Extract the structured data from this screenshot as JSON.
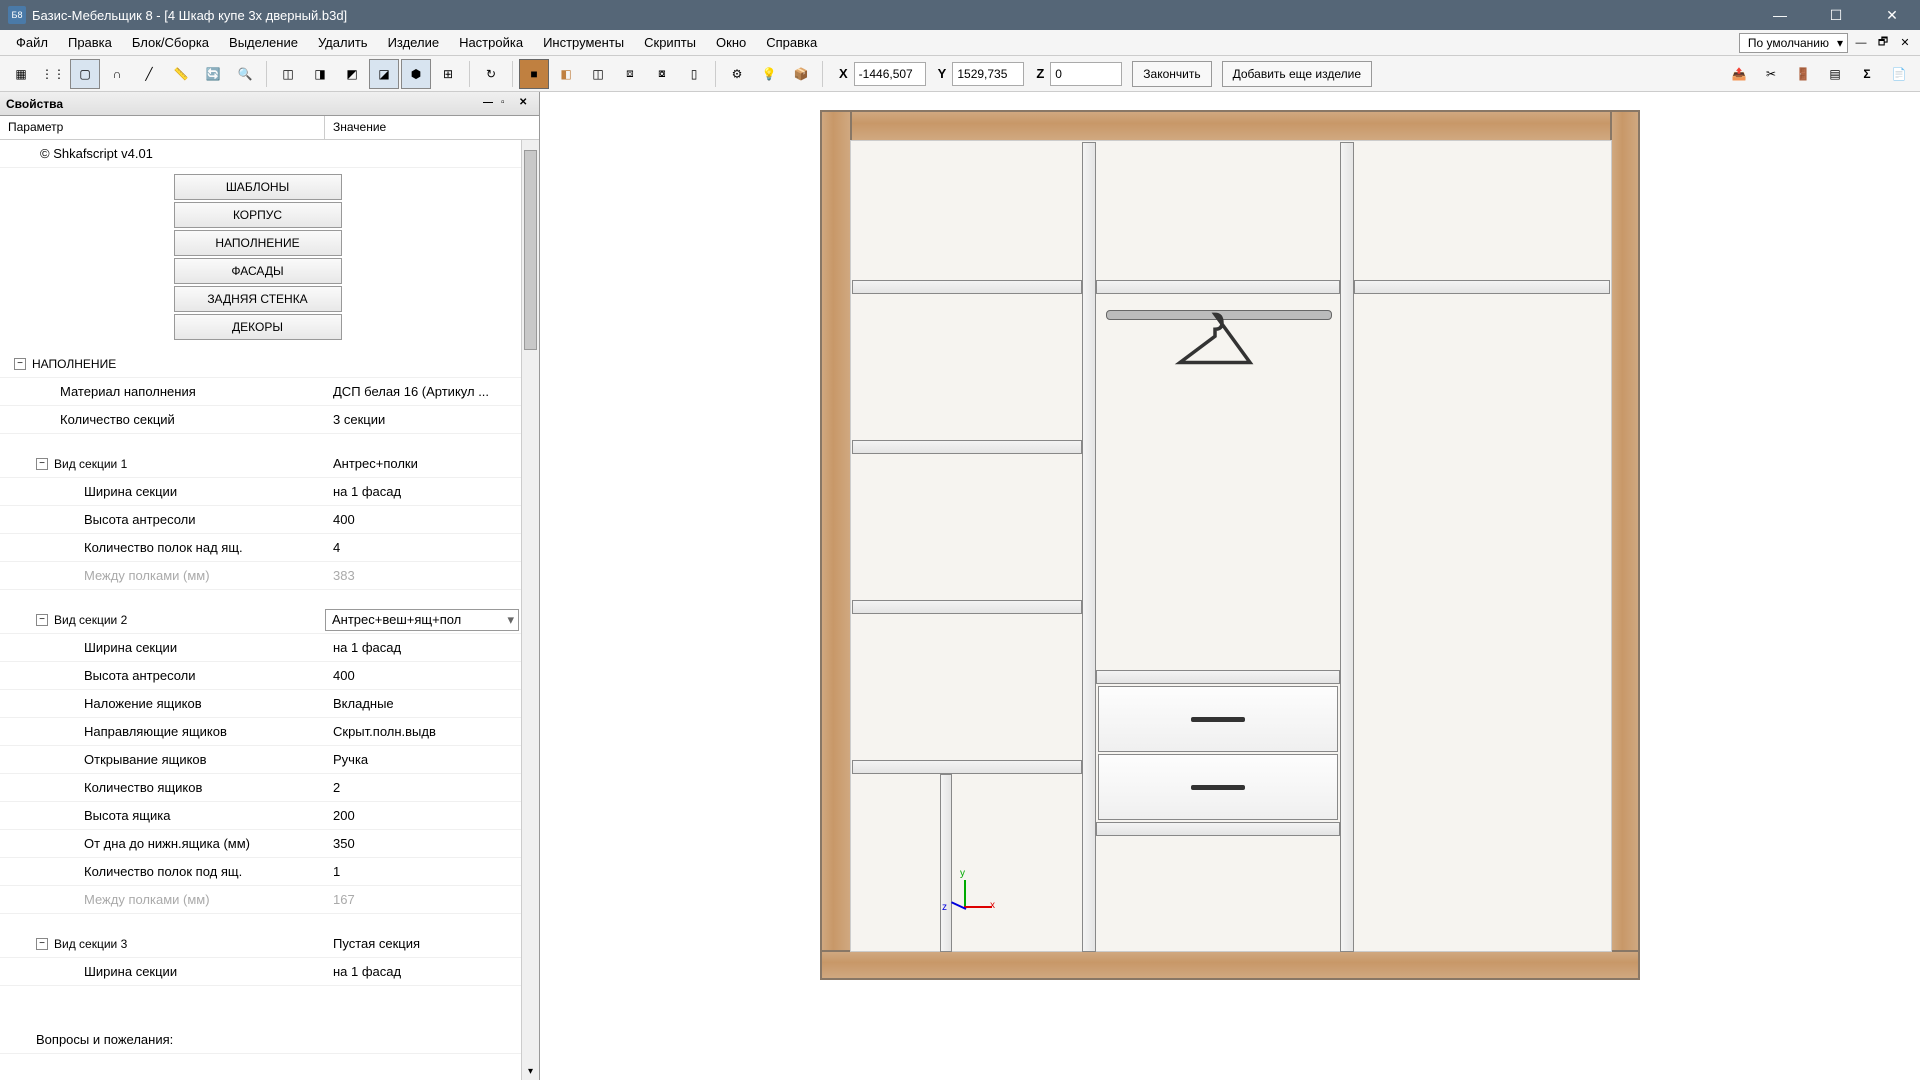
{
  "title": "Базис-Мебельщик 8 - [4 Шкаф купе 3х дверный.b3d]",
  "menu": [
    "Файл",
    "Правка",
    "Блок/Сборка",
    "Выделение",
    "Удалить",
    "Изделие",
    "Настройка",
    "Инструменты",
    "Скрипты",
    "Окно",
    "Справка"
  ],
  "layout_combo": "По умолчанию",
  "coords": {
    "x": "-1446,507",
    "y": "1529,735",
    "z": "0"
  },
  "actions": {
    "finish": "Закончить",
    "add_more": "Добавить еще изделие"
  },
  "props": {
    "title": "Свойства",
    "col1": "Параметр",
    "col2": "Значение",
    "script": "© Shkafscript v4.01",
    "buttons": [
      "ШАБЛОНЫ",
      "КОРПУС",
      "НАПОЛНЕНИЕ",
      "ФАСАДЫ",
      "ЗАДНЯЯ СТЕНКА",
      "ДЕКОРЫ"
    ],
    "fill_group": "НАПОЛНЕНИЕ",
    "fill": {
      "material_l": "Материал наполнения",
      "material_v": "ДСП белая 16 (Артикул ...",
      "sections_l": "Количество секций",
      "sections_v": "3 секции"
    },
    "s1": {
      "title": "Вид секции 1",
      "val": "Антрес+полки",
      "width_l": "Ширина секции",
      "width_v": "на 1 фасад",
      "antr_l": "Высота антресоли",
      "antr_v": "400",
      "shelves_l": "Количество полок над ящ.",
      "shelves_v": "4",
      "gap_l": "Между полками (мм)",
      "gap_v": "383"
    },
    "s2": {
      "title": "Вид секции 2",
      "val": "Антрес+веш+ящ+пол",
      "width_l": "Ширина секции",
      "width_v": "на 1 фасад",
      "antr_l": "Высота антресоли",
      "antr_v": "400",
      "overlay_l": "Наложение ящиков",
      "overlay_v": "Вкладные",
      "guides_l": "Направляющие ящиков",
      "guides_v": "Скрыт.полн.выдв",
      "open_l": "Открывание ящиков",
      "open_v": "Ручка",
      "count_l": "Количество ящиков",
      "count_v": "2",
      "height_l": "Высота ящика",
      "height_v": "200",
      "bottom_l": "От дна до нижн.ящика (мм)",
      "bottom_v": "350",
      "below_l": "Количество полок под ящ.",
      "below_v": "1",
      "gap_l": "Между полками (мм)",
      "gap_v": "167"
    },
    "s3": {
      "title": "Вид секции 3",
      "val": "Пустая секция",
      "width_l": "Ширина секции",
      "width_v": "на 1 фасад"
    },
    "footer": "Вопросы и пожелания:"
  },
  "axis": {
    "x": "x",
    "y": "y",
    "z": "z"
  }
}
